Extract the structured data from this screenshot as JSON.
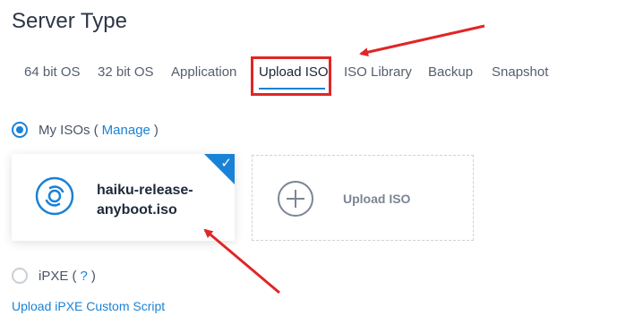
{
  "page": {
    "title": "Server Type"
  },
  "tabs": [
    {
      "label": "64 bit OS"
    },
    {
      "label": "32 bit OS"
    },
    {
      "label": "Application"
    },
    {
      "label": "Upload ISO"
    },
    {
      "label": "ISO Library"
    },
    {
      "label": "Backup"
    },
    {
      "label": "Snapshot"
    }
  ],
  "active_tab": "Upload ISO",
  "my_isos": {
    "label": "My ISOs (",
    "manage_link": "Manage",
    "close": ")",
    "selected": true
  },
  "iso_card": {
    "name": "haiku-release-anyboot.iso",
    "selected": true
  },
  "upload_card": {
    "label": "Upload ISO"
  },
  "ipxe": {
    "label": "iPXE (",
    "help_link": "?",
    "close": ")",
    "selected": false
  },
  "ipxe_script_link": "Upload iPXE Custom Script",
  "colors": {
    "accent": "#1a82d6",
    "annotation": "#e02626"
  }
}
